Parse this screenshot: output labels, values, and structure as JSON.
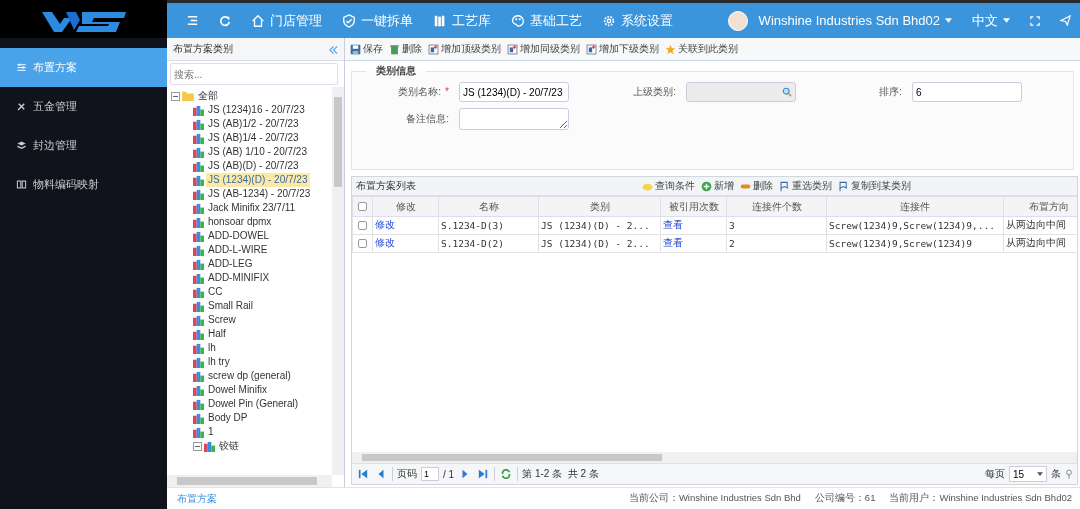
{
  "topbar": {
    "nav": [
      {
        "label": "门店管理"
      },
      {
        "label": "一键拆单"
      },
      {
        "label": "工艺库"
      },
      {
        "label": "基础工艺"
      },
      {
        "label": "系统设置"
      }
    ],
    "user": "Winshine Industries Sdn Bhd02",
    "language": "中文"
  },
  "sidebar": {
    "items": [
      {
        "label": "布置方案",
        "selected": true
      },
      {
        "label": "五金管理",
        "selected": false
      },
      {
        "label": "封边管理",
        "selected": false
      },
      {
        "label": "物料编码映射",
        "selected": false
      }
    ]
  },
  "tree": {
    "title": "布置方案类别",
    "search": {
      "placeholder": "搜索..."
    },
    "nodes": [
      {
        "label": "全部",
        "kind": "folder",
        "expanded": true,
        "children": [
          {
            "label": "JS (1234)16 - 20/7/23",
            "selected": false
          },
          {
            "label": "JS (AB)1/2 - 20/7/23",
            "selected": false
          },
          {
            "label": "JS (AB)1/4 - 20/7/23",
            "selected": false
          },
          {
            "label": "JS (AB) 1/10 - 20/7/23",
            "selected": false
          },
          {
            "label": "JS (AB)(D) - 20/7/23",
            "selected": false
          },
          {
            "label": "JS (1234)(D) - 20/7/23",
            "selected": true
          },
          {
            "label": "JS (AB-1234) - 20/7/23",
            "selected": false
          },
          {
            "label": "Jack Minifix 23/7/11",
            "selected": false
          },
          {
            "label": "honsoar dpmx",
            "selected": false
          },
          {
            "label": "ADD-DOWEL",
            "selected": false
          },
          {
            "label": "ADD-L-WIRE",
            "selected": false
          },
          {
            "label": "ADD-LEG",
            "selected": false
          },
          {
            "label": "ADD-MINIFIX",
            "selected": false
          },
          {
            "label": "CC",
            "selected": false
          },
          {
            "label": "Small Rail",
            "selected": false
          },
          {
            "label": "Screw",
            "selected": false
          },
          {
            "label": "Half",
            "selected": false
          },
          {
            "label": "lh",
            "selected": false
          },
          {
            "label": "lh try",
            "selected": false
          },
          {
            "label": "screw dp (general)",
            "selected": false
          },
          {
            "label": "Dowel Minifix",
            "selected": false
          },
          {
            "label": "Dowel Pin (General)",
            "selected": false
          },
          {
            "label": "Body DP",
            "selected": false
          },
          {
            "label": "1",
            "selected": false
          },
          {
            "label": "铰链",
            "selected": false,
            "expanded": true
          }
        ]
      }
    ],
    "footer_link": "布置方案"
  },
  "toolbar": [
    {
      "label": "保存"
    },
    {
      "label": "删除"
    },
    {
      "label": "增加顶级类别"
    },
    {
      "label": "增加同级类别"
    },
    {
      "label": "增加下级类别"
    },
    {
      "label": "关联到此类别"
    }
  ],
  "form": {
    "legend": "类别信息",
    "fields": [
      {
        "kind": "text",
        "label": "类别名称:",
        "marker": "*",
        "value": "JS (1234)(D) - 20/7/23"
      },
      {
        "kind": "lookup",
        "label": "上级类别:",
        "disabled": true
      },
      {
        "kind": "text",
        "label": "排序:",
        "value": "6"
      },
      {
        "kind": "textarea",
        "label": "备注信息:"
      }
    ]
  },
  "grid": {
    "title": "布置方案列表",
    "actions": [
      {
        "label": "查询条件"
      },
      {
        "label": "新增"
      },
      {
        "label": "删除"
      },
      {
        "label": "重选类别"
      },
      {
        "label": "复制到某类别"
      }
    ],
    "all_checked": false,
    "columns": [
      {
        "label": "修改",
        "kind": "link"
      },
      {
        "label": "名称",
        "kind": "text"
      },
      {
        "label": "类别",
        "kind": "text"
      },
      {
        "label": "被引用次数",
        "kind": "link"
      },
      {
        "label": "连接件个数",
        "kind": "text"
      },
      {
        "label": "连接件",
        "kind": "text"
      },
      {
        "label": "布置方向",
        "kind": "text"
      }
    ],
    "rows": [
      {
        "checked": false,
        "cells": [
          "修改",
          "S.1234-D(3)",
          "JS (1234)(D) - 2...",
          "查看",
          "3",
          "Screw(1234)9,Screw(1234)9,...",
          "从两边向中间"
        ]
      },
      {
        "checked": false,
        "cells": [
          "修改",
          "S.1234-D(2)",
          "JS (1234)(D) - 2...",
          "查看",
          "2",
          "Screw(1234)9,Screw(1234)9",
          "从两边向中间"
        ]
      }
    ],
    "pager": {
      "page_label": "页码",
      "page": "1",
      "total_pages": "/ 1",
      "summary": "第 1-2 条  共 2 条",
      "per_page_label": "每页",
      "per_page": "15",
      "unit": "条"
    }
  },
  "status_bar": [
    "当前公司：Winshine Industries Sdn Bhd",
    "公司编号：61",
    "当前用户：Winshine Industries Sdn Bhd02"
  ]
}
